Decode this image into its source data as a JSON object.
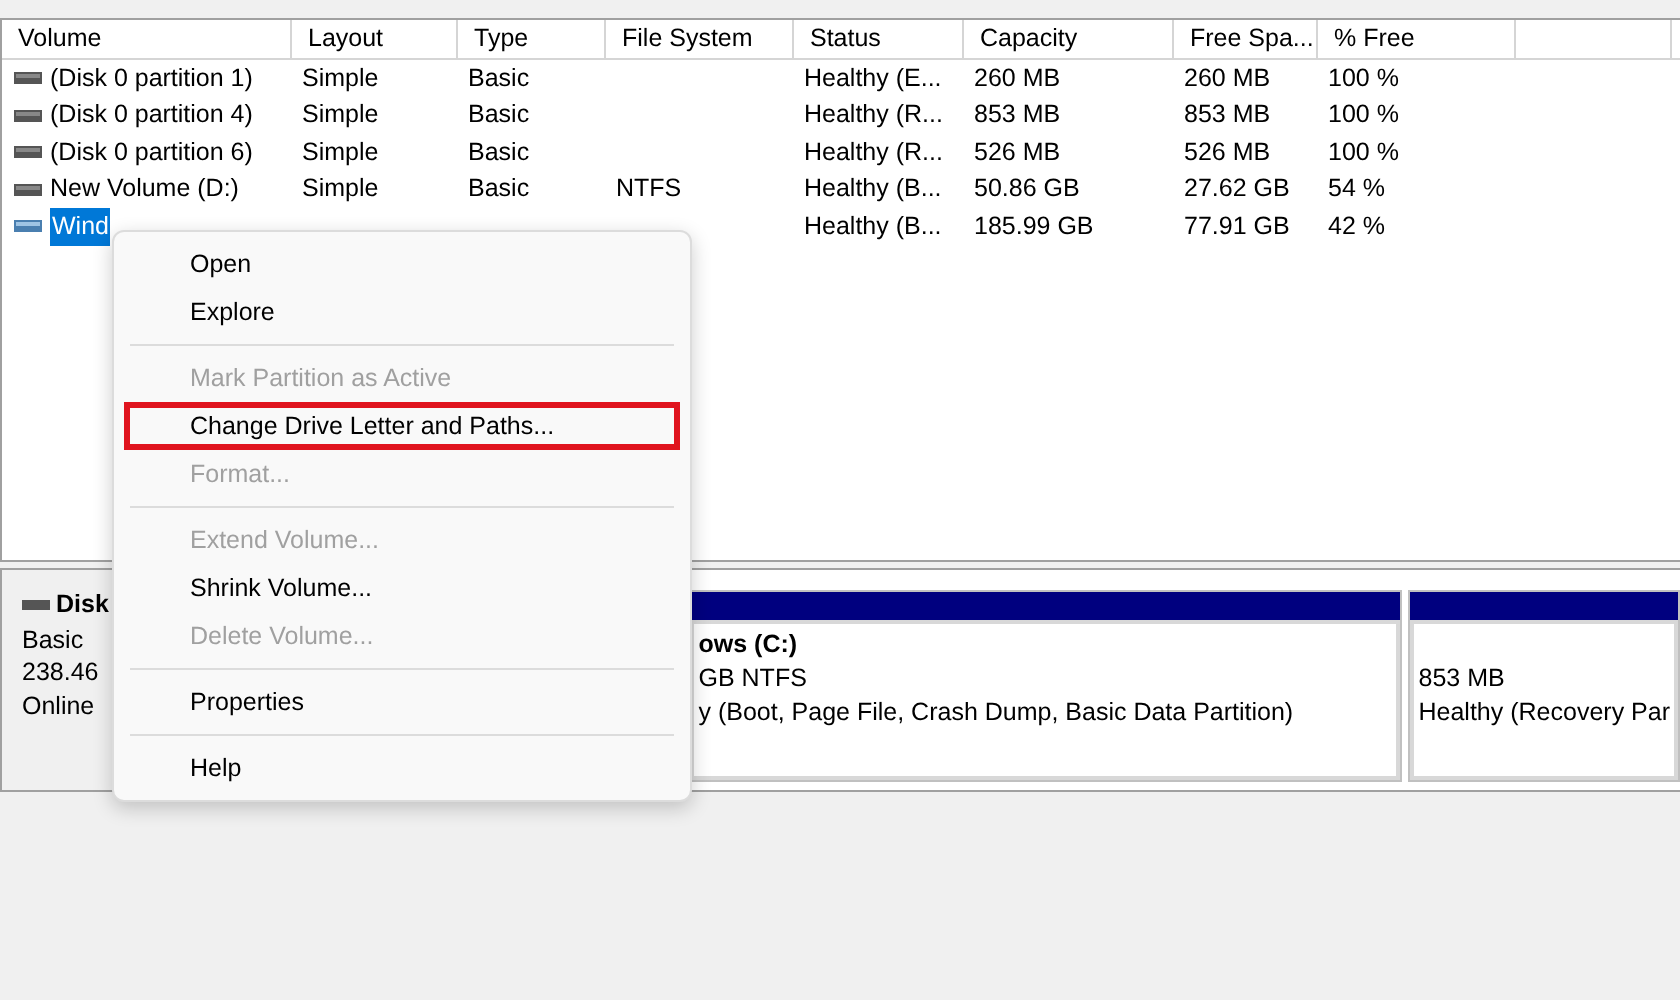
{
  "table": {
    "columns": [
      "Volume",
      "Layout",
      "Type",
      "File System",
      "Status",
      "Capacity",
      "Free Spa...",
      "% Free"
    ],
    "rows": [
      {
        "volume": "(Disk 0 partition 1)",
        "layout": "Simple",
        "type": "Basic",
        "status": "Healthy (E...",
        "capacity": "260 MB",
        "free": "260 MB",
        "pct": "100 %",
        "selected": false
      },
      {
        "volume": "(Disk 0 partition 4)",
        "layout": "Simple",
        "type": "Basic",
        "status": "Healthy (R...",
        "capacity": "853 MB",
        "free": "853 MB",
        "pct": "100 %",
        "selected": false
      },
      {
        "volume": "(Disk 0 partition 6)",
        "layout": "Simple",
        "type": "Basic",
        "status": "Healthy (R...",
        "capacity": "526 MB",
        "free": "526 MB",
        "pct": "100 %",
        "selected": false
      },
      {
        "volume": "New Volume (D:)",
        "layout": "Simple",
        "type": "Basic",
        "fs": "NTFS",
        "status": "Healthy (B...",
        "capacity": "50.86 GB",
        "free": "27.62 GB",
        "pct": "54 %",
        "selected": false
      },
      {
        "volume": "Wind",
        "status": "Healthy (B...",
        "capacity": "185.99 GB",
        "free": "77.91 GB",
        "pct": "42 %",
        "selected": true
      }
    ]
  },
  "context_menu": [
    {
      "kind": "item",
      "label": "Open",
      "disabled": false,
      "highlighted": false
    },
    {
      "kind": "item",
      "label": "Explore",
      "disabled": false,
      "highlighted": false
    },
    {
      "kind": "separator"
    },
    {
      "kind": "item",
      "label": "Mark Partition as Active",
      "disabled": true,
      "highlighted": false
    },
    {
      "kind": "item",
      "label": "Change Drive Letter and Paths...",
      "disabled": false,
      "highlighted": true
    },
    {
      "kind": "item",
      "label": "Format...",
      "disabled": true,
      "highlighted": false
    },
    {
      "kind": "separator"
    },
    {
      "kind": "item",
      "label": "Extend Volume...",
      "disabled": true,
      "highlighted": false
    },
    {
      "kind": "item",
      "label": "Shrink Volume...",
      "disabled": false,
      "highlighted": false
    },
    {
      "kind": "item",
      "label": "Delete Volume...",
      "disabled": true,
      "highlighted": false
    },
    {
      "kind": "separator"
    },
    {
      "kind": "item",
      "label": "Properties",
      "disabled": false,
      "highlighted": false
    },
    {
      "kind": "separator"
    },
    {
      "kind": "item",
      "label": "Help",
      "disabled": false,
      "highlighted": false
    }
  ],
  "disk": {
    "name": "Disk",
    "lines": [
      "Basic",
      "238.46",
      "Online"
    ],
    "partitions": [
      {
        "title": "ows  (C:)",
        "lines": [
          "GB NTFS",
          "y (Boot, Page File, Crash Dump, Basic Data Partition)"
        ]
      },
      {
        "lines": [
          "853 MB",
          "Healthy (Recovery Par"
        ]
      }
    ]
  }
}
